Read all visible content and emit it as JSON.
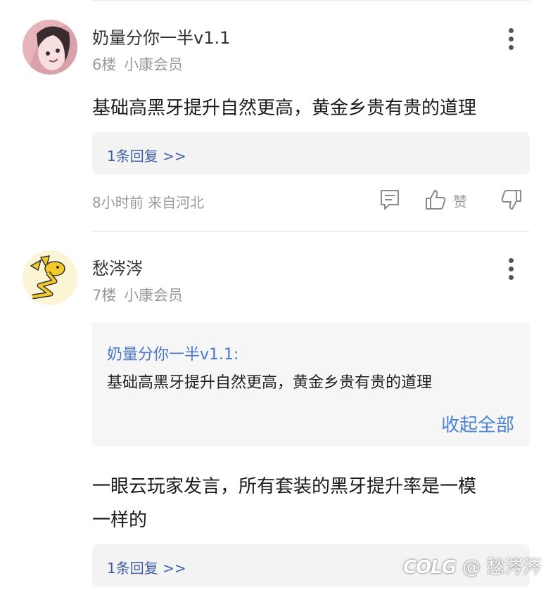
{
  "comments": [
    {
      "username": "奶量分你一半v1.1",
      "floor": "6楼",
      "member_badge": "小康会员",
      "content": "基础高黑牙提升自然更高，黄金乡贵有贵的道理",
      "reply_link": "1条回复 >>",
      "time_location": "8小时前 来自河北",
      "like_label": "赞"
    },
    {
      "username": "愁涔涔",
      "floor": "7楼",
      "member_badge": "小康会员",
      "quote_author": "奶量分你一半v1.1:",
      "quote_text": "基础高黑牙提升自然更高，黄金乡贵有贵的道理",
      "collapse_label": "收起全部",
      "content_line1": "一眼云玩家发言，所有套装的黑牙提升率是一模",
      "content_line2": "一样的",
      "reply_link": "1条回复 >>"
    }
  ],
  "watermark": {
    "logo": "COLG",
    "text": "@ 愁涔涔"
  },
  "colors": {
    "link_blue": "#3e5ea8",
    "quote_name_blue": "#4a78c8",
    "collapse_blue": "#4a84d2",
    "meta_gray": "#9a9a9a",
    "reply_bg": "#f3f3f3"
  }
}
